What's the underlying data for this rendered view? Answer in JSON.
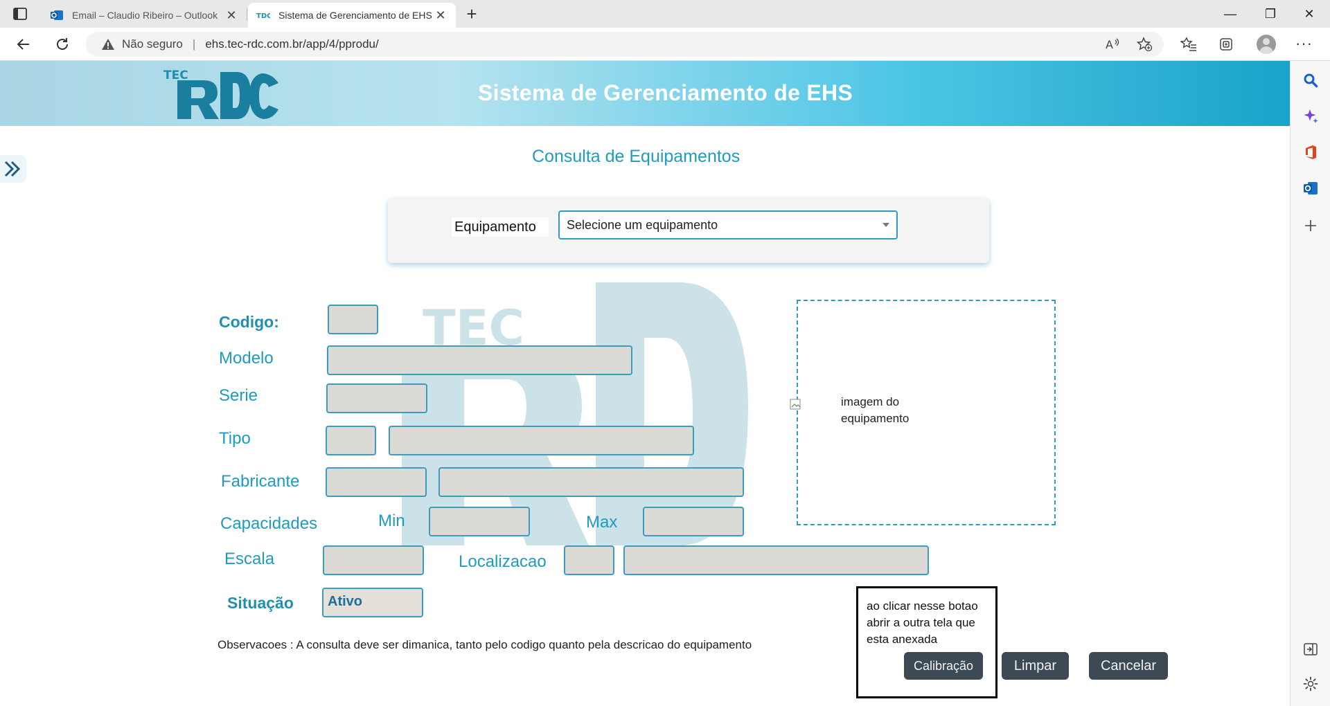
{
  "browser": {
    "tabs": [
      {
        "title": "Email – Claudio Ribeiro – Outlook",
        "active": false
      },
      {
        "title": "Sistema de Gerenciamento de EHS",
        "active": true
      }
    ],
    "not_secure": "Não seguro",
    "url": "ehs.tec-rdc.com.br/app/4/pprodu/"
  },
  "banner": {
    "logo_text": "TEC RDC",
    "title": "Sistema de Gerenciamento de EHS"
  },
  "page": {
    "title": "Consulta de Equipamentos",
    "equipment_label": "Equipamento",
    "equipment_select": "Selecione um  equipamento"
  },
  "form": {
    "codigo": "Codigo:",
    "modelo": "Modelo",
    "serie": "Serie",
    "tipo": "Tipo",
    "fabricante": "Fabricante",
    "capacidades": "Capacidades",
    "min": "Min",
    "max": "Max",
    "escala": "Escala",
    "localizacao": "Localizacao",
    "situacao": "Situação",
    "situacao_value": "Ativo"
  },
  "image": {
    "caption": "imagem do equipamento"
  },
  "observacoes": "Observacoes : A consulta deve ser dimanica, tanto pelo codigo quanto pela  descricao do equipamento",
  "note": "ao clicar nesse botao abrir a outra tela que esta anexada",
  "buttons": {
    "calibracao": "Calibração",
    "limpar": "Limpar",
    "cancelar": "Cancelar"
  },
  "colors": {
    "accent": "#1e9bbf",
    "field_bg": "#dcdad4",
    "button_bg": "#3d4954"
  }
}
